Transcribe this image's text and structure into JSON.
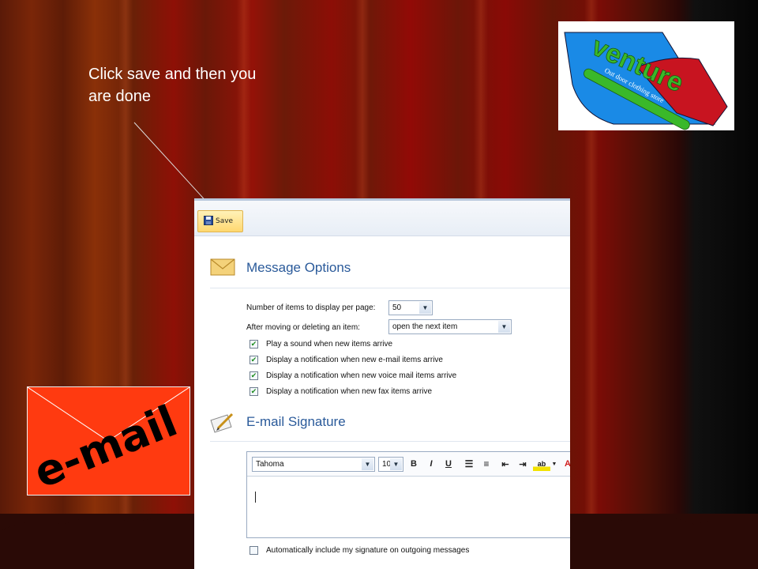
{
  "slide": {
    "callout_text": "Click save and then you are done",
    "logo": {
      "word": "venture",
      "tagline": "Out door clothing store",
      "colors": {
        "blue": "#1a8ae6",
        "red": "#c81420",
        "green": "#3ab82a"
      }
    },
    "email_card": {
      "word": "e-mail",
      "color": "#ff3a10"
    }
  },
  "panel": {
    "toolbar": {
      "save_label": "Save",
      "save_icon": "floppy-disk-icon"
    },
    "message_options": {
      "title": "Message Options",
      "icon": "envelope-icon",
      "items_per_page_label": "Number of items to display per page:",
      "items_per_page_value": "50",
      "after_moving_label": "After moving or deleting an item:",
      "after_moving_value": "open the next item",
      "checkboxes": [
        {
          "label": "Play a sound when new items arrive",
          "checked": true
        },
        {
          "label": "Display a notification when new e-mail items arrive",
          "checked": true
        },
        {
          "label": "Display a notification when new voice mail items arrive",
          "checked": true
        },
        {
          "label": "Display a notification when new fax items arrive",
          "checked": true
        }
      ]
    },
    "signature": {
      "title": "E-mail Signature",
      "icon": "signature-pen-icon",
      "font_value": "Tahoma",
      "size_value": "10",
      "bold_label": "B",
      "italic_label": "I",
      "underline_label": "U",
      "auto_include_label": "Automatically include my signature on outgoing messages",
      "auto_include_checked": false
    }
  }
}
